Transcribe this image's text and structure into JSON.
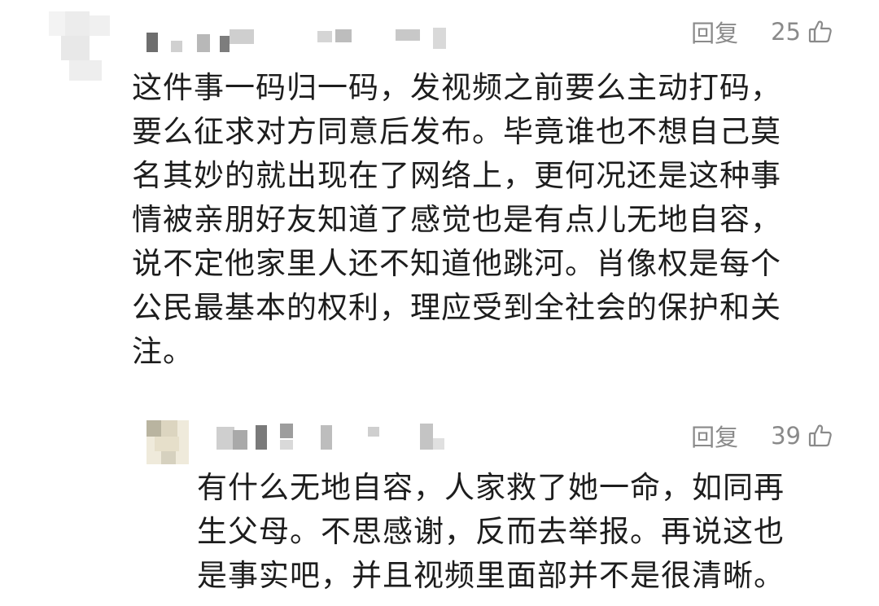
{
  "comments": [
    {
      "reply_label": "回复",
      "likes": "25",
      "thumb_icon": "thumbs-up-icon",
      "text_lines": [
        "这件事一码归一码，发视频之前要么主动打码，",
        "要么征求对方同意后发布。毕竟谁也不想自己莫",
        "名其妙的就出现在了网络上，更何况还是这种事",
        "情被亲朋好友知道了感觉也是有点儿无地自容，",
        "说不定他家里人还不知道他跳河。肖像权是每个",
        "公民最基本的权利，理应受到全社会的保护和关",
        "注。"
      ]
    },
    {
      "reply_label": "回复",
      "likes": "39",
      "thumb_icon": "thumbs-up-icon",
      "text_lines": [
        "有什么无地自容，人家救了她一命，如同再",
        "生父母。不思感谢，反而去举报。再说这也",
        "是事实吧，并且视频里面部并不是很清晰。"
      ]
    }
  ],
  "colors": {
    "meta_gray": "#8a8a8a",
    "text": "#1d1d1d",
    "mosaic_light": "#e6e6e6",
    "mosaic_mid": "#c9c9c9",
    "mosaic_dark": "#6e6e6e",
    "mosaic_tan": "#e9e3d3"
  }
}
